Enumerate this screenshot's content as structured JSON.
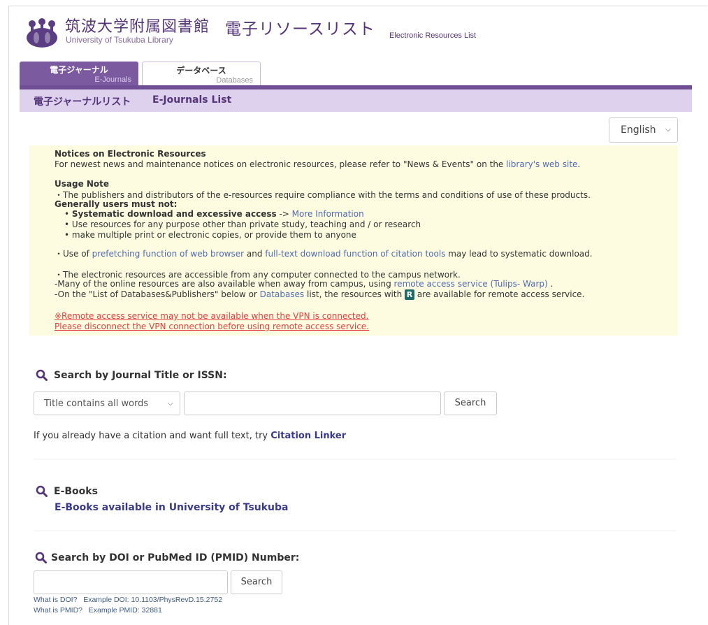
{
  "header": {
    "library_jp": "筑波大学附属図書館",
    "library_en": "University of Tsukuba Library",
    "resources_jp": "電子リソースリスト",
    "resources_en": "Electronic Resources List"
  },
  "tabs": [
    {
      "label_jp": "電子ジャーナル",
      "label_en": "E-Journals",
      "active": true
    },
    {
      "label_jp": "データベース",
      "label_en": "Databases",
      "active": false
    }
  ],
  "subnav": {
    "title_jp": "電子ジャーナルリスト",
    "title_en": "E-Journals List"
  },
  "language_select": {
    "value": "English",
    "chevron": "chevron-down-icon"
  },
  "notice": {
    "title": "Notices on Electronic Resources",
    "text1": "For newest news and maintenance notices on electronic resources, please refer to \"News & Events\" on the ",
    "text1_link": "library's web site",
    "text1_end": ".",
    "usage_title": "Usage Note",
    "usage_text": "・The publishers and distributors of the e-resources require compliance with the terms and conditions of use of these products.",
    "must_not": "Generally users must not:",
    "bullet1_bold": "Systematic download and excessive access",
    "bullet1_arrow": " -> ",
    "bullet1_link": "More Information",
    "bullet2": "Use resources for any purpose other than private study, teaching and / or research",
    "bullet3": "make multiple print or electronic copies, or provide them to anyone",
    "prefetch_pre": "・Use of ",
    "prefetch_link1": "prefetching function of web browser",
    "prefetch_mid": " and ",
    "prefetch_link2": "full-text download function of citation tools",
    "prefetch_end": " may lead to systematic download.",
    "campus": "・The electronic resources are accessible from any computer connected to the campus network.",
    "remote_pre": "-Many of the online resources are also available when away from campus, using ",
    "remote_link": "remote access service (Tulips- Warp)",
    "remote_end": " .",
    "list_pre": "-On the \"List of Databases&Publishers\" below or ",
    "list_link": "Databases",
    "list_mid": " list, the resources with ",
    "list_badge": "R",
    "list_end": " are available for remote access service.",
    "vpn1": "※Remote access service may not be available when the VPN is connected.",
    "vpn2": "Please disconnect the VPN connection before using remote access service."
  },
  "journal_search": {
    "title": "Search by Journal Title or ISSN:",
    "select_value": "Title contains all words",
    "button": "Search"
  },
  "citation": {
    "text": "If you already have a citation and want full text, try ",
    "link": "Citation Linker"
  },
  "ebooks": {
    "title": "E-Books",
    "link": "E-Books available in University of Tsukuba"
  },
  "doi_search": {
    "title": "Search by DOI or PubMed ID (PMID) Number:",
    "button": "Search",
    "doi_link": "What is DOI?",
    "doi_example": "Example DOI: 10.1103/PhysRevD.15.2752",
    "pmid_link": "What is PMID?",
    "pmid_example": "Example PMID: 32881"
  },
  "colors": {
    "brand_purple": "#6f4e96",
    "notice_bg": "#fdfce0",
    "warning_red": "#e04040"
  }
}
